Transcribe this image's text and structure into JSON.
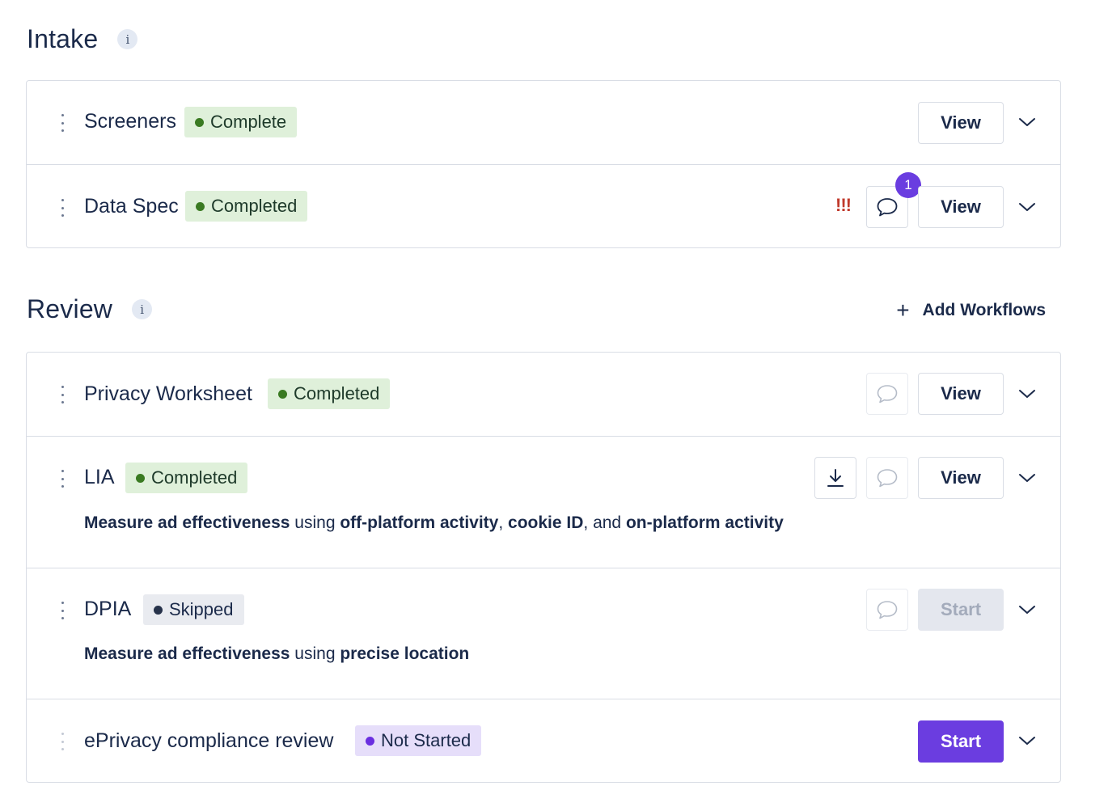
{
  "intake": {
    "title": "Intake",
    "info_icon": "i",
    "rows": [
      {
        "name": "Screeners",
        "status": "Complete",
        "action": "View"
      },
      {
        "name": "Data Spec",
        "status": "Completed",
        "alert": "!!!",
        "comment_count": "1",
        "action": "View"
      }
    ]
  },
  "review": {
    "title": "Review",
    "info_icon": "i",
    "add_workflows": "Add Workflows",
    "rows": [
      {
        "name": "Privacy Worksheet",
        "status": "Completed",
        "action": "View"
      },
      {
        "name": "LIA",
        "status": "Completed",
        "action": "View",
        "desc": {
          "p1": "Measure ad effectiveness",
          "p2": " using ",
          "p3": "off-platform activity",
          "p4": ", ",
          "p5": "cookie ID",
          "p6": ", and ",
          "p7": "on-platform activity"
        }
      },
      {
        "name": "DPIA",
        "status": "Skipped",
        "action": "Start",
        "desc": {
          "p1": "Measure ad effectiveness",
          "p2": " using ",
          "p3": "precise location"
        }
      },
      {
        "name": "ePrivacy compliance review",
        "status": "Not Started",
        "action": "Start"
      }
    ]
  },
  "colors": {
    "completed_badge_bg": "#dff0da",
    "completed_dot": "#3a7a22",
    "skipped_badge_bg": "#e9ebf0",
    "not_started_badge_bg": "#e6defa",
    "primary": "#6b3de0",
    "alert": "#c0392b"
  },
  "icons": [
    "drag-handle-icon",
    "info-icon",
    "chevron-down-icon",
    "comment-icon",
    "download-icon",
    "plus-icon"
  ]
}
